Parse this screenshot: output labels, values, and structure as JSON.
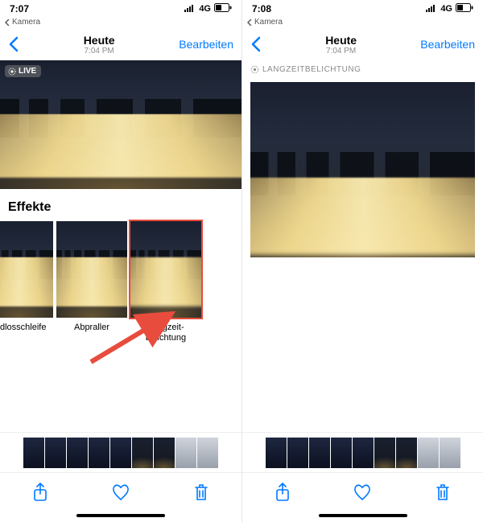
{
  "left": {
    "status": {
      "time": "7:07",
      "network": "4G"
    },
    "breadcrumb": "Kamera",
    "nav": {
      "title": "Heute",
      "subtitle": "7:04 PM",
      "edit": "Bearbeiten"
    },
    "live_badge": "LIVE",
    "effects": {
      "title": "Effekte",
      "items": [
        {
          "label": "Endlosschleife"
        },
        {
          "label": "Abpraller"
        },
        {
          "label": "Langzeit-\nbelichtung"
        }
      ]
    }
  },
  "right": {
    "status": {
      "time": "7:08",
      "network": "4G"
    },
    "breadcrumb": "Kamera",
    "nav": {
      "title": "Heute",
      "subtitle": "7:04 PM",
      "edit": "Bearbeiten"
    },
    "mode_badge": "LANGZEITBELICHTUNG"
  }
}
